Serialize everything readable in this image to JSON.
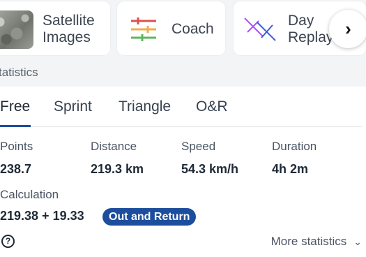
{
  "cards": [
    {
      "label_line1": "Satellite",
      "label_line2": "Images",
      "icon": "satellite-thumbnail"
    },
    {
      "label": "Coach",
      "icon": "sliders-icon"
    },
    {
      "label_line1": "Day",
      "label_line2": "Replay",
      "icon": "gliders-icon"
    }
  ],
  "next_icon": "chevron-right-icon",
  "section": {
    "title": "tatistics"
  },
  "tabs": [
    {
      "label": "Free",
      "active": true
    },
    {
      "label": "Sprint"
    },
    {
      "label": "Triangle"
    },
    {
      "label": "O&R"
    }
  ],
  "stats": [
    {
      "label": "Points",
      "value": "238.7"
    },
    {
      "label": "Distance",
      "value": "219.3 km"
    },
    {
      "label": "Speed",
      "value": "54.3 km/h"
    },
    {
      "label": "Duration",
      "value": "4h 2m"
    }
  ],
  "calculation": {
    "label": "Calculation",
    "value": "219.38 + 19.33",
    "badge": "Out and Return"
  },
  "help_icon": "?",
  "more_statistics": "More statistics",
  "colors": {
    "accent": "#1d4e9e",
    "background": "#f3f4f6"
  }
}
